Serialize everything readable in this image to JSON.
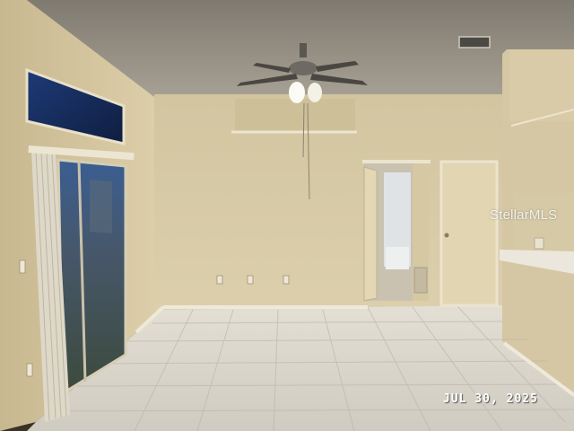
{
  "photo": {
    "watermark": "StellarMLS",
    "date_stamp": "JUL 30, 2025"
  },
  "colors": {
    "ceiling": "#9a9488",
    "wall_left": "#d9c9a4",
    "wall_back": "#d8cba6",
    "floor": "#d6d2c8",
    "door": "#e2d5b2",
    "baseboard": "#ece6d6"
  }
}
